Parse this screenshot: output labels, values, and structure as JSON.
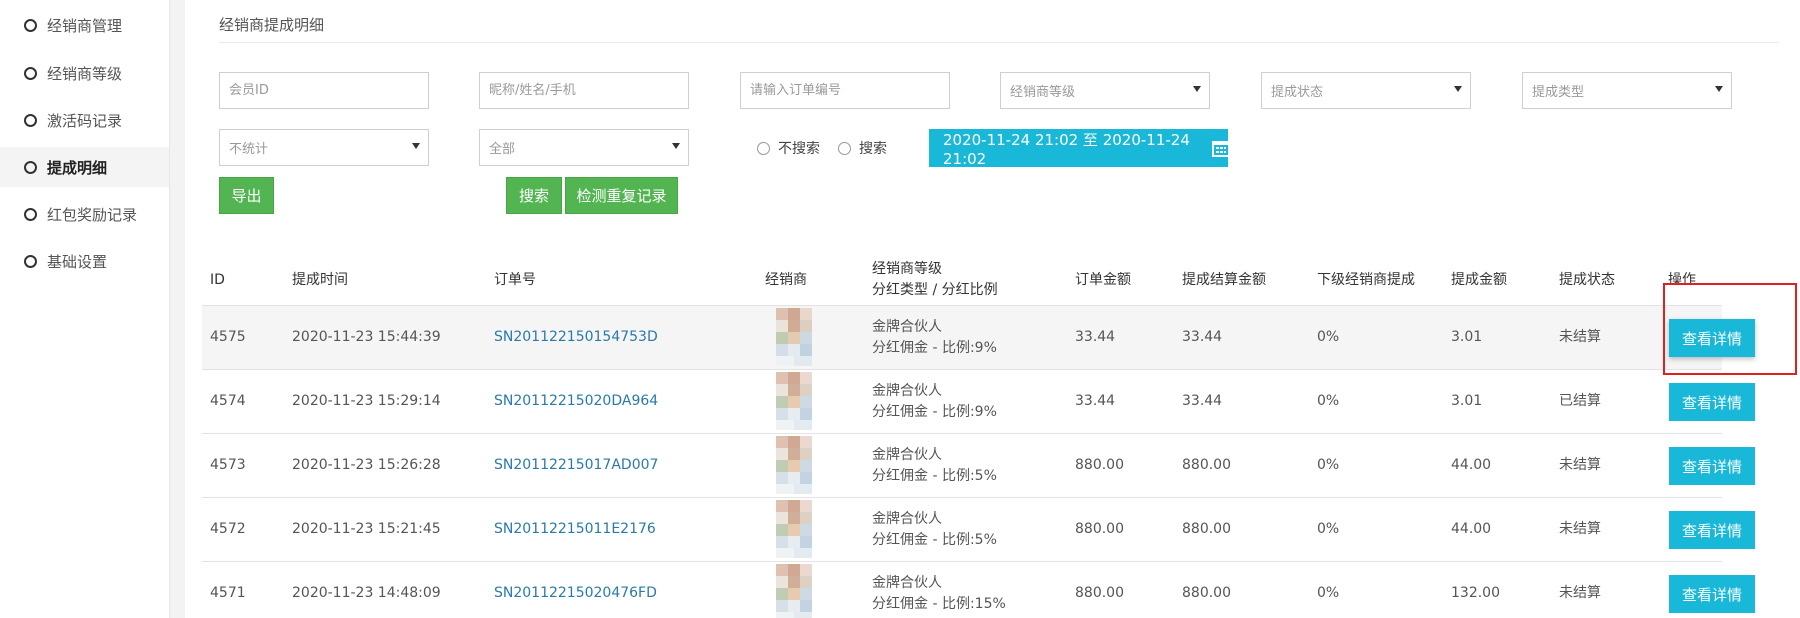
{
  "sidebar": {
    "items": [
      {
        "label": "经销商管理"
      },
      {
        "label": "经销商等级"
      },
      {
        "label": "激活码记录"
      },
      {
        "label": "提成明细"
      },
      {
        "label": "红包奖励记录"
      },
      {
        "label": "基础设置"
      }
    ],
    "active_index": 3
  },
  "page": {
    "title": "经销商提成明细"
  },
  "filters": {
    "member_id_placeholder": "会员ID",
    "name_placeholder": "昵称/姓名/手机",
    "order_placeholder": "请输入订单编号",
    "level_select": "经销商等级",
    "status_select": "提成状态",
    "type_select": "提成类型",
    "stat_select": "不统计",
    "all_select": "全部",
    "radio_no_search": "不搜索",
    "radio_search": "搜索",
    "date_range": "2020-11-24 21:02 至 2020-11-24 21:02"
  },
  "buttons": {
    "export": "导出",
    "search": "搜索",
    "check_duplicates": "检测重复记录"
  },
  "table": {
    "headers": {
      "id": "ID",
      "time": "提成时间",
      "order": "订单号",
      "dealer": "经销商",
      "level_line1": "经销商等级",
      "level_line2": "分红类型 / 分红比例",
      "order_amount": "订单金额",
      "settle_amount": "提成结算金额",
      "sub_commission": "下级经销商提成",
      "commission": "提成金额",
      "status": "提成状态",
      "action": "操作"
    },
    "rows": [
      {
        "id": "4575",
        "time": "2020-11-23 15:44:39",
        "order": "SN201122150154753D",
        "level": "金牌合伙人",
        "ratio": "分红佣金 - 比例:9%",
        "order_amount": "33.44",
        "settle_amount": "33.44",
        "sub": "0%",
        "commission": "3.01",
        "status": "未结算",
        "action": "查看详情"
      },
      {
        "id": "4574",
        "time": "2020-11-23 15:29:14",
        "order": "SN20112215020DA964",
        "level": "金牌合伙人",
        "ratio": "分红佣金 - 比例:9%",
        "order_amount": "33.44",
        "settle_amount": "33.44",
        "sub": "0%",
        "commission": "3.01",
        "status": "已结算",
        "action": "查看详情"
      },
      {
        "id": "4573",
        "time": "2020-11-23 15:26:28",
        "order": "SN20112215017AD007",
        "level": "金牌合伙人",
        "ratio": "分红佣金 - 比例:5%",
        "order_amount": "880.00",
        "settle_amount": "880.00",
        "sub": "0%",
        "commission": "44.00",
        "status": "未结算",
        "action": "查看详情"
      },
      {
        "id": "4572",
        "time": "2020-11-23 15:21:45",
        "order": "SN20112215011E2176",
        "level": "金牌合伙人",
        "ratio": "分红佣金 - 比例:5%",
        "order_amount": "880.00",
        "settle_amount": "880.00",
        "sub": "0%",
        "commission": "44.00",
        "status": "未结算",
        "action": "查看详情"
      },
      {
        "id": "4571",
        "time": "2020-11-23 14:48:09",
        "order": "SN20112215020476FD",
        "level": "金牌合伙人",
        "ratio": "分红佣金 - 比例:15%",
        "order_amount": "880.00",
        "settle_amount": "880.00",
        "sub": "0%",
        "commission": "132.00",
        "status": "未结算",
        "action": "查看详情"
      }
    ]
  },
  "colors": {
    "accent_cyan": "#1ab8d8",
    "button_green": "#52b552",
    "link_blue": "#2a7aa8",
    "highlight_red": "#e02020"
  }
}
